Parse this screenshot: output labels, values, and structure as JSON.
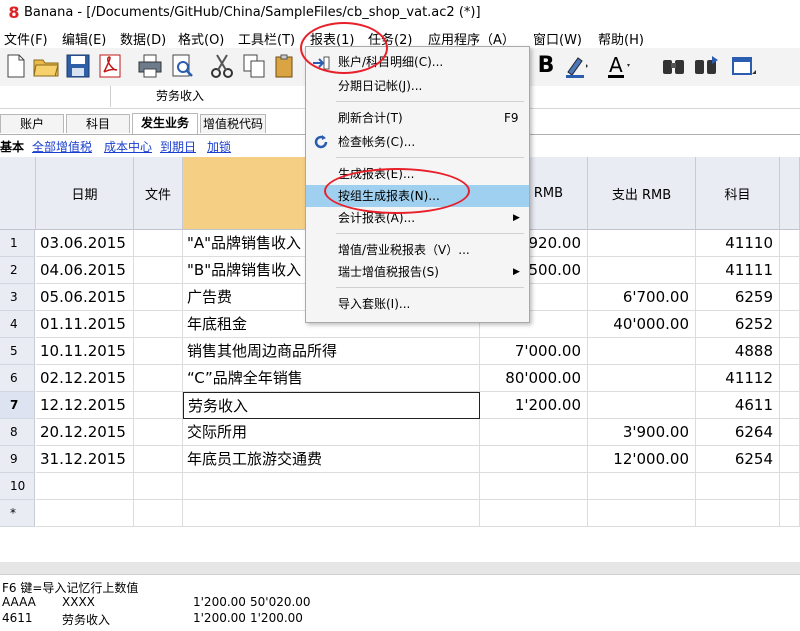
{
  "window": {
    "title": "Banana - [/Documents/GitHub/China/SampleFiles/cb_shop_vat.ac2 (*)]"
  },
  "menu": [
    "文件(F)",
    "编辑(E)",
    "数据(D)",
    "格式(O)",
    "工具栏(T)",
    "报表(1)",
    "任务(2)",
    "应用程序（A）",
    "窗口(W)",
    "帮助(H)"
  ],
  "context": {
    "cell_value": "劳务收入"
  },
  "tabs": [
    "账户",
    "科目",
    "发生业务",
    "增值税代码"
  ],
  "views": {
    "current": "基本",
    "links": [
      "全部增值税",
      "成本中心",
      "到期日",
      "加锁"
    ]
  },
  "table": {
    "headers": {
      "date": "日期",
      "doc": "文件",
      "desc": "",
      "income": "RMB",
      "expense": "支出 RMB",
      "account": "科目"
    },
    "rows": [
      {
        "n": "1",
        "date": "03.06.2015",
        "desc": "\"A\"品牌销售收入",
        "income": "'920.00",
        "expense": "",
        "account": "41110"
      },
      {
        "n": "2",
        "date": "04.06.2015",
        "desc": "\"B\"品牌销售收入",
        "income": "'500.00",
        "expense": "",
        "account": "41111"
      },
      {
        "n": "3",
        "date": "05.06.2015",
        "desc": "广告费",
        "income": "",
        "expense": "6'700.00",
        "account": "6259"
      },
      {
        "n": "4",
        "date": "01.11.2015",
        "desc": "年底租金",
        "income": "",
        "expense": "40'000.00",
        "account": "6252"
      },
      {
        "n": "5",
        "date": "10.11.2015",
        "desc": "销售其他周边商品所得",
        "income": "7'000.00",
        "expense": "",
        "account": "4888"
      },
      {
        "n": "6",
        "date": "02.12.2015",
        "desc": "“C”品牌全年销售",
        "income": "80'000.00",
        "expense": "",
        "account": "41112"
      },
      {
        "n": "7",
        "date": "12.12.2015",
        "desc": "劳务收入",
        "income": "1'200.00",
        "expense": "",
        "account": "4611"
      },
      {
        "n": "8",
        "date": "20.12.2015",
        "desc": "交际所用",
        "income": "",
        "expense": "3'900.00",
        "account": "6264"
      },
      {
        "n": "9",
        "date": "31.12.2015",
        "desc": "年底员工旅游交通费",
        "income": "",
        "expense": "12'000.00",
        "account": "6254"
      },
      {
        "n": "10",
        "date": "",
        "desc": "",
        "income": "",
        "expense": "",
        "account": ""
      },
      {
        "n": "*",
        "date": "",
        "desc": "",
        "income": "",
        "expense": "",
        "account": ""
      }
    ],
    "active_row": "7"
  },
  "status": {
    "hint": "F6 键=导入记忆行上数值",
    "lines": [
      {
        "code": "AAAA",
        "name": "XXXX",
        "amount": "1'200.00",
        "balance": "50'020.00"
      },
      {
        "code": "4611",
        "name": "劳务收入",
        "amount": "1'200.00",
        "balance": "1'200.00"
      }
    ]
  },
  "report_menu": {
    "items": [
      {
        "label": "账户/科目明细(C)...",
        "shortcut": "",
        "submenu": false
      },
      {
        "label": "分期日记帐(J)...",
        "shortcut": "",
        "submenu": false
      },
      {
        "label": "刷新合计(T)",
        "shortcut": "F9",
        "submenu": false
      },
      {
        "label": "检查帐务(C)...",
        "shortcut": "",
        "submenu": false
      },
      {
        "label": "生成报表(E)...",
        "shortcut": "",
        "submenu": false
      },
      {
        "label": "按组生成报表(N)...",
        "shortcut": "",
        "submenu": false
      },
      {
        "label": "会计报表(A)...",
        "shortcut": "",
        "submenu": true
      },
      {
        "label": "增值/营业税报表（V）...",
        "shortcut": "",
        "submenu": false
      },
      {
        "label": "瑞士增值税报告(S)",
        "shortcut": "",
        "submenu": true
      },
      {
        "label": "导入套账(I)...",
        "shortcut": "",
        "submenu": false
      }
    ],
    "highlighted_index": 5
  },
  "colors": {
    "annotation": "#e8202a",
    "highlight": "#9fd0f0",
    "link": "#1a3ecf"
  }
}
